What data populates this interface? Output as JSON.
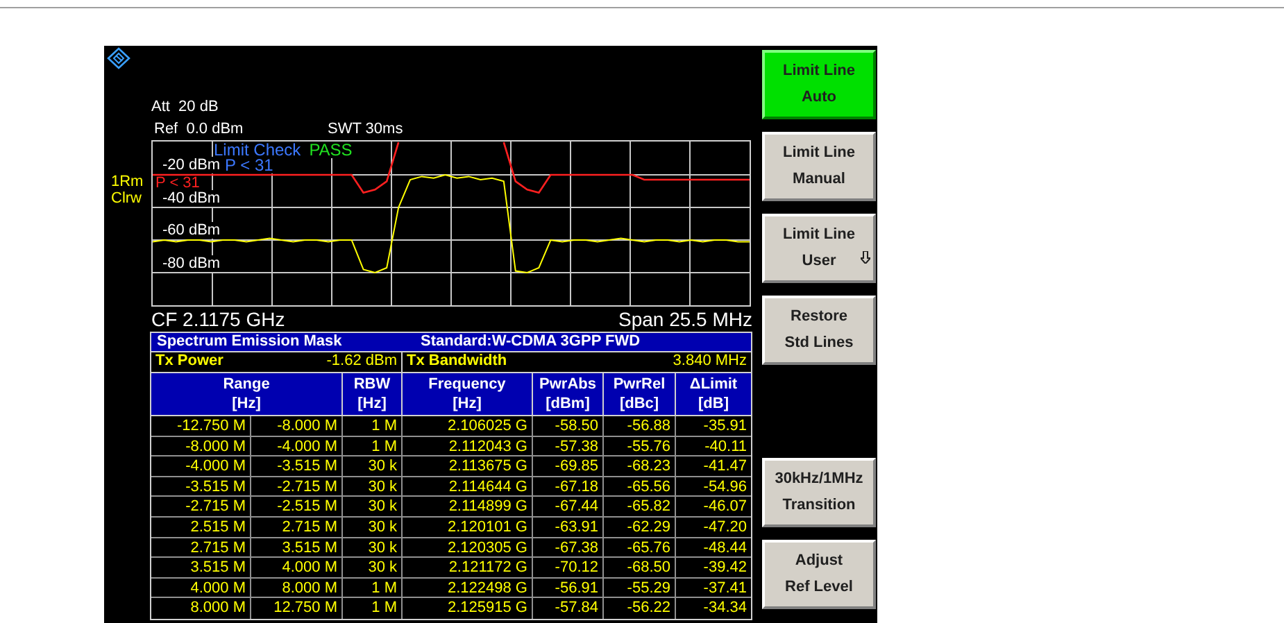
{
  "instrument": {
    "att": "Att  20 dB",
    "ref": "Ref  0.0 dBm",
    "swt": "SWT 30ms"
  },
  "graph": {
    "limit_check": "Limit Check",
    "result": "PASS",
    "limit_line_name": "P < 31",
    "chart_data": {
      "type": "line",
      "grid": true,
      "ylim": [
        -100,
        0
      ],
      "yticks": [
        {
          "value": -20,
          "label": "-20 dBm"
        },
        {
          "value": -40,
          "label": "-40 dBm"
        },
        {
          "value": -60,
          "label": "-60 dBm"
        },
        {
          "value": -80,
          "label": "-80 dBm"
        }
      ],
      "categories": [
        null,
        null,
        null,
        null,
        null,
        null,
        null,
        null,
        null,
        null,
        null,
        null,
        null,
        null,
        null,
        null,
        null,
        null,
        null,
        null,
        null,
        null,
        null,
        null,
        null,
        null,
        null,
        null,
        null,
        null,
        null,
        null,
        null,
        null,
        null,
        null,
        null,
        null,
        null,
        null,
        null,
        null,
        null,
        null,
        null,
        null,
        null,
        null,
        null,
        null,
        null,
        null
      ],
      "series": [
        {
          "name": "1Rm Clrw",
          "color": "#ffff00",
          "values": [
            -61,
            -60,
            -61,
            -60,
            -60,
            -61,
            -60,
            -60,
            -61,
            -60,
            -59,
            -60,
            -61,
            -60,
            -60,
            -61,
            -60,
            -60,
            -78,
            -80,
            -77,
            -40,
            -23,
            -21,
            -22,
            -20,
            -22,
            -21,
            -23,
            -22,
            -24,
            -79,
            -80,
            -77,
            -60,
            -61,
            -60,
            -60,
            -61,
            -60,
            -59,
            -60,
            -61,
            -60,
            -60,
            -61,
            -60,
            -61,
            -60,
            -60,
            -61,
            -61
          ]
        },
        {
          "name": "P < 31",
          "color": "#ff2020",
          "values": [
            -20,
            -20,
            -20,
            -20,
            -20,
            -20,
            -20,
            -20,
            -20,
            -20,
            -20,
            -20,
            -20,
            -20,
            -20,
            -20,
            -20,
            -20,
            -31,
            -29,
            -24,
            0,
            null,
            null,
            null,
            null,
            null,
            null,
            null,
            null,
            0,
            -24,
            -29,
            -31,
            -20,
            -20,
            -20,
            -20,
            -20,
            -20,
            -20,
            -20,
            -23,
            -23,
            -23,
            -23,
            -23,
            -23,
            -23,
            -23,
            -23,
            -23
          ]
        }
      ]
    }
  },
  "cf": "CF 2.1175 GHz",
  "span": "Span 25.5 MHz",
  "table": {
    "title": "Spectrum Emission Mask",
    "standard": "Standard:W-CDMA 3GPP FWD",
    "tx_power_label": "Tx Power",
    "tx_power": "-1.62 dBm",
    "tx_bandwidth_label": "Tx Bandwidth",
    "tx_bandwidth": "3.840 MHz",
    "columns": [
      {
        "name": "Range",
        "unit": "[Hz]"
      },
      {
        "name": "RBW",
        "unit": "[Hz]"
      },
      {
        "name": "Frequency",
        "unit": "[Hz]"
      },
      {
        "name": "PwrAbs",
        "unit": "[dBm]"
      },
      {
        "name": "PwrRel",
        "unit": "[dBc]"
      },
      {
        "name": "ΔLimit",
        "unit": "[dB]"
      }
    ],
    "rows": [
      [
        [
          "-12.750 M",
          "-8.000 M"
        ],
        "1 M",
        "2.106025 G",
        "-58.50",
        "-56.88",
        "-35.91"
      ],
      [
        [
          "-8.000 M",
          "-4.000 M"
        ],
        "1 M",
        "2.112043 G",
        "-57.38",
        "-55.76",
        "-40.11"
      ],
      [
        [
          "-4.000 M",
          "-3.515 M"
        ],
        "30 k",
        "2.113675 G",
        "-69.85",
        "-68.23",
        "-41.47"
      ],
      [
        [
          "-3.515 M",
          "-2.715 M"
        ],
        "30 k",
        "2.114644 G",
        "-67.18",
        "-65.56",
        "-54.96"
      ],
      [
        [
          "-2.715 M",
          "-2.515 M"
        ],
        "30 k",
        "2.114899 G",
        "-67.44",
        "-65.82",
        "-46.07"
      ],
      [
        [
          "2.515 M",
          "2.715 M"
        ],
        "30 k",
        "2.120101 G",
        "-63.91",
        "-62.29",
        "-47.20"
      ],
      [
        [
          "2.715 M",
          "3.515 M"
        ],
        "30 k",
        "2.120305 G",
        "-67.38",
        "-65.76",
        "-48.44"
      ],
      [
        [
          "3.515 M",
          "4.000 M"
        ],
        "30 k",
        "2.121172 G",
        "-70.12",
        "-68.50",
        "-39.42"
      ],
      [
        [
          "4.000 M",
          "8.000 M"
        ],
        "1 M",
        "2.122498 G",
        "-56.91",
        "-55.29",
        "-37.41"
      ],
      [
        [
          "8.000 M",
          "12.750 M"
        ],
        "1 M",
        "2.125915 G",
        "-57.84",
        "-56.22",
        "-34.34"
      ]
    ]
  },
  "softkeys_upper": [
    {
      "lines": [
        "Limit Line",
        "Auto"
      ],
      "selected": true,
      "submenu": false
    },
    {
      "lines": [
        "Limit Line",
        "Manual"
      ],
      "selected": false,
      "submenu": false
    },
    {
      "lines": [
        "Limit Line",
        "User"
      ],
      "selected": false,
      "submenu": true
    },
    {
      "lines": [
        "Restore",
        "Std Lines"
      ],
      "selected": false,
      "submenu": false
    }
  ],
  "softkeys_lower": [
    {
      "lines": [
        "30kHz/1MHz",
        "Transition"
      ],
      "selected": false,
      "submenu": false
    },
    {
      "lines": [
        "Adjust",
        "Ref Level"
      ],
      "selected": false,
      "submenu": false
    }
  ]
}
